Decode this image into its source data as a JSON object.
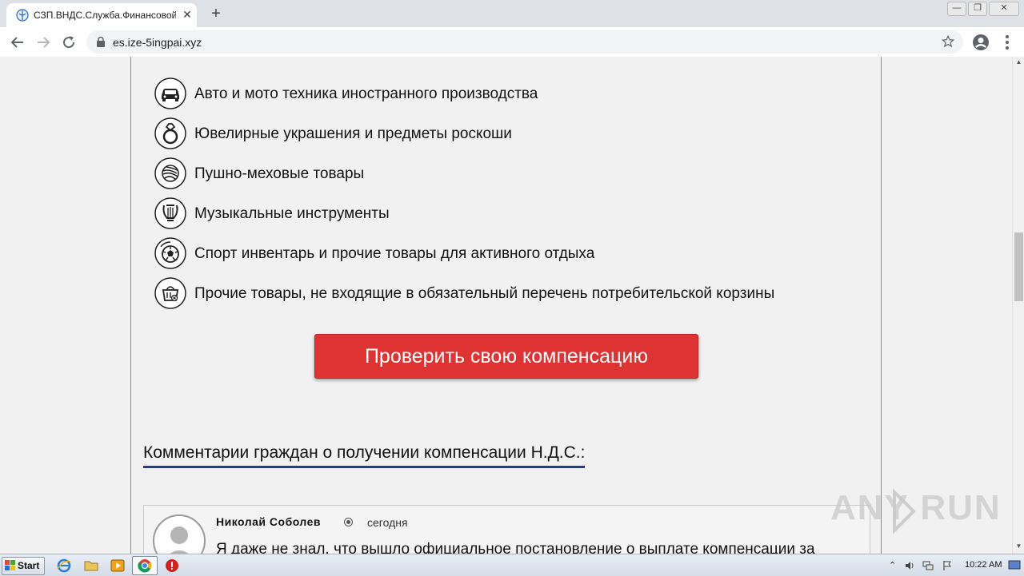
{
  "browser": {
    "tab_title": "СЗП.ВНДС.Служба.Финансовой.За",
    "tab_close": "✕",
    "new_tab": "+",
    "url": "es.ize-5ingpai.xyz",
    "window_controls": {
      "minimize": "—",
      "restore": "❐",
      "close": "✕"
    }
  },
  "categories": [
    {
      "icon": "car-icon",
      "label": "Авто и мото техника иностранного производства"
    },
    {
      "icon": "ring-icon",
      "label": "Ювелирные украшения и предметы роскоши"
    },
    {
      "icon": "fur-icon",
      "label": "Пушно-меховые товары"
    },
    {
      "icon": "lyre-icon",
      "label": "Музыкальные инструменты"
    },
    {
      "icon": "soccer-ball-icon",
      "label": "Спорт инвентарь и прочие товары для активного отдыха"
    },
    {
      "icon": "basket-icon",
      "label": "Прочие товары, не входящие в обязательный перечень потребительской корзины"
    }
  ],
  "cta": {
    "label": "Проверить свою компенсацию"
  },
  "comments": {
    "heading": "Комментарии граждан о получении компенсации Н.Д.С.:",
    "items": [
      {
        "author": "Николай Соболев",
        "date": "сегодня",
        "text": "Я даже не знал, что вышло официальное постановление о выплате компенсации за"
      }
    ]
  },
  "watermark": "ANY RUN",
  "taskbar": {
    "start_label": "Start",
    "clock": "10:22 AM"
  }
}
